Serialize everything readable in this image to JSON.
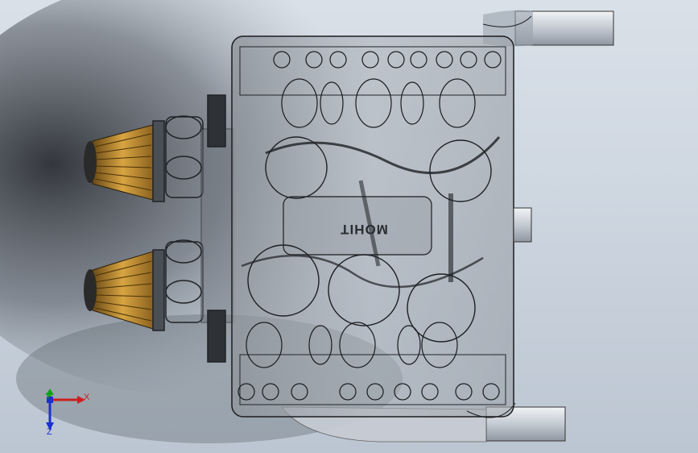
{
  "viewport": {
    "model_label_text": "MOHIT",
    "background_colors": [
      "#d9e0e8",
      "#bcc6d2"
    ],
    "shadow_color": "#3a3d42",
    "filter_color": "#c8962e"
  },
  "triad": {
    "x_label": "X",
    "y_label": "Y",
    "z_label": "Z",
    "x_color": "#cc1f1f",
    "y_color": "#12a012",
    "z_color": "#1c2fd0"
  }
}
